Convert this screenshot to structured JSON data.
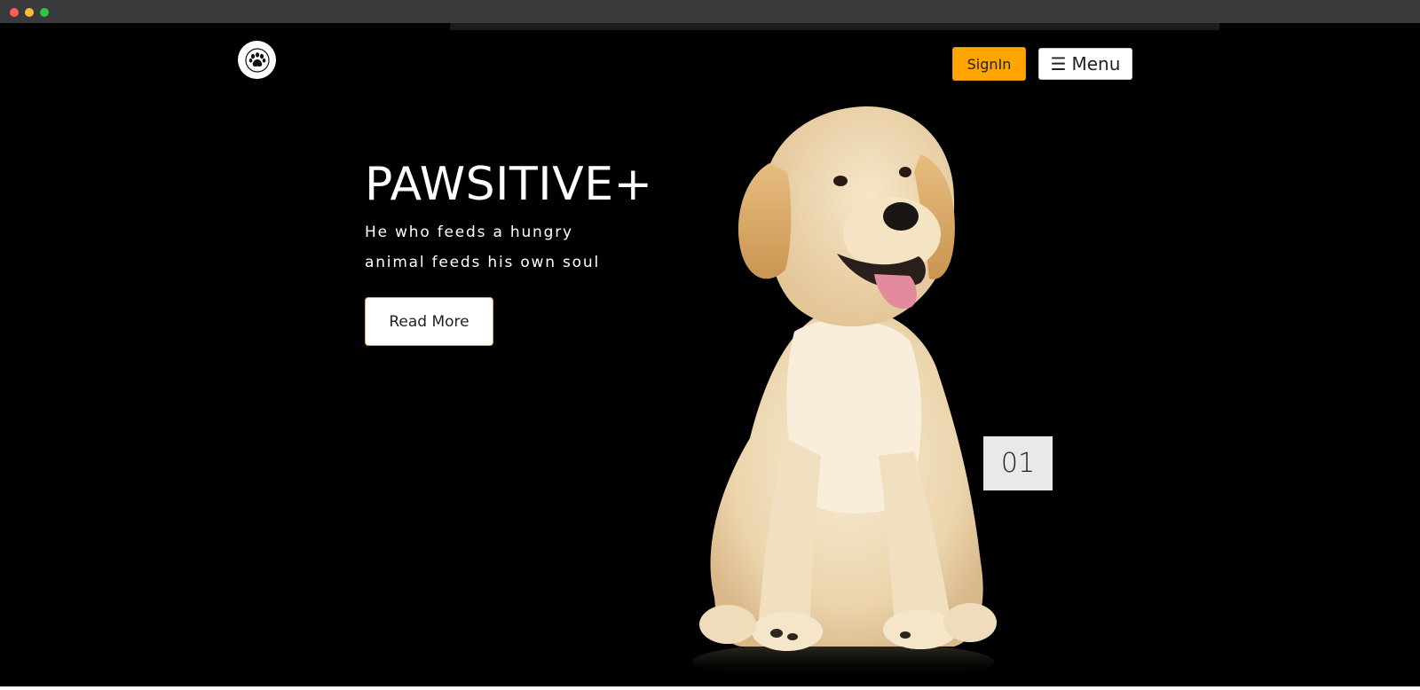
{
  "nav": {
    "logo_icon": "paw-icon",
    "signin_label": "SignIn",
    "menu_icon": "☰",
    "menu_label": "Menu"
  },
  "hero": {
    "title": "PAWSITIVE+",
    "subtitle_line1": "He who feeds a hungry",
    "subtitle_line2": "animal feeds his own soul",
    "read_more_label": "Read More"
  },
  "slider": {
    "counter": "01"
  },
  "colors": {
    "background": "#000000",
    "accent": "#ffa500",
    "counter_bg": "#e9e9e9"
  }
}
